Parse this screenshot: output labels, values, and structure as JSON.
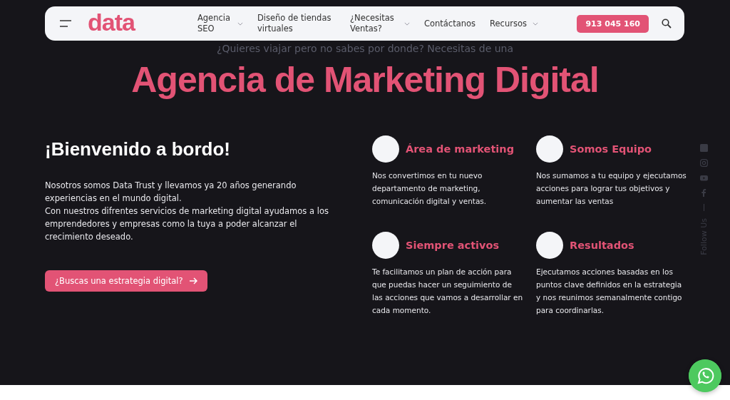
{
  "nav": {
    "logo": "data",
    "items": [
      {
        "label": "Agencia SEO",
        "dropdown": true
      },
      {
        "label": "Diseño de tiendas virtuales",
        "dropdown": false
      },
      {
        "label": "¿Necesitas Ventas?",
        "dropdown": true
      },
      {
        "label": "Contáctanos",
        "dropdown": false
      },
      {
        "label": "Recursos",
        "dropdown": true
      }
    ],
    "phone": "913 045 160"
  },
  "hero": {
    "subtitle": "¿Quieres viajar pero no sabes por donde? Necesitas de una",
    "title": "Agencia de Marketing Digital"
  },
  "intro": {
    "heading": "¡Bienvenido a bordo!",
    "paragraphs": [
      "Nosotros somos Data Trust y llevamos ya 20 años generando experiencias en el mundo digital.",
      "Con nuestros difrentes servicios de marketing digital ayudamos a los emprendedores y empresas como la tuya a poder alcanzar el crecimiento deseado."
    ],
    "cta": "¿Buscas una estrategia digital?"
  },
  "features": [
    {
      "title": "Área de marketing",
      "text": "Nos convertimos en tu nuevo departamento de marketing, comunicación digital y ventas."
    },
    {
      "title": "Somos Equipo",
      "text": "Nos sumamos a tu equipo y ejecutamos acciones para lograr tus objetivos y aumentar las ventas"
    },
    {
      "title": "Siempre activos",
      "text": "Te facilitamos un plan de acción para que puedas hacer un seguimiento de las acciones que vamos a desarrollar en cada momento."
    },
    {
      "title": "Resultados",
      "text": "Ejecutamos acciones basadas en los puntos clave definidos en la estrategia y nos reunimos semanalmente contigo para coordinarlas."
    }
  ],
  "social": {
    "label": "Follow Us"
  }
}
